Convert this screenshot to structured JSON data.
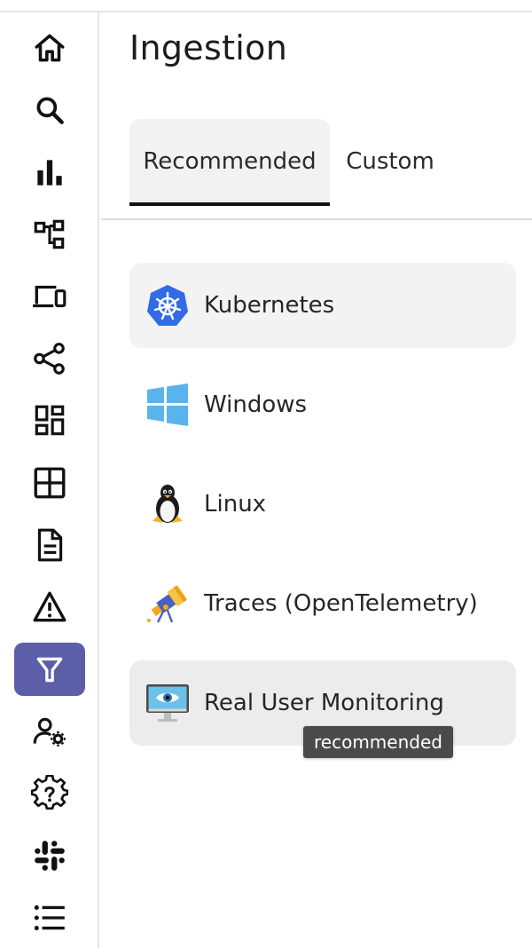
{
  "header": {
    "title": "Ingestion"
  },
  "tabs": [
    {
      "label": "Recommended",
      "active": true
    },
    {
      "label": "Custom",
      "active": false
    }
  ],
  "items": [
    {
      "label": "Kubernetes",
      "icon": "kubernetes-icon"
    },
    {
      "label": "Windows",
      "icon": "windows-icon"
    },
    {
      "label": "Linux",
      "icon": "linux-tux-icon"
    },
    {
      "label": "Traces (OpenTelemetry)",
      "icon": "telescope-icon"
    },
    {
      "label": "Real User Monitoring",
      "icon": "monitor-eye-icon"
    }
  ],
  "tooltip": {
    "text": "recommended"
  },
  "sidebar": {
    "icons": [
      "home-icon",
      "search-icon",
      "bar-chart-icon",
      "service-map-icon",
      "devices-icon",
      "share-icon",
      "dashboard-icon",
      "grid-icon",
      "document-icon",
      "alert-icon",
      "filter-icon",
      "user-settings-icon",
      "help-settings-icon",
      "slack-icon",
      "list-icon"
    ],
    "active": "filter-icon"
  },
  "colors": {
    "accent": "#5c5fa8",
    "kubernetes": "#326ce5",
    "windows": "#5ab4ec",
    "tooltip_bg": "#4a4a4a"
  }
}
